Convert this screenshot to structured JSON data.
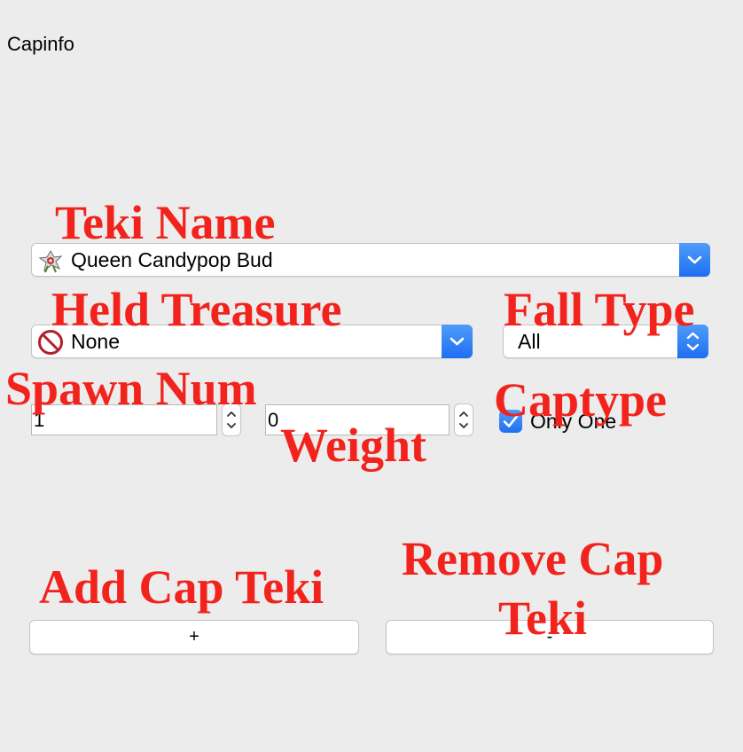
{
  "window": {
    "title": "Capinfo"
  },
  "annotations": {
    "teki_name": "Teki Name",
    "held_treasure": "Held Treasure",
    "fall_type": "Fall Type",
    "spawn_num": "Spawn Num",
    "weight": "Weight",
    "captype": "Captype",
    "add_cap_teki": "Add Cap Teki",
    "remove_cap_teki_line1": "Remove Cap",
    "remove_cap_teki_line2": "Teki"
  },
  "teki_select": {
    "value": "Queen Candypop Bud",
    "icon": "candypop-bud-icon"
  },
  "treasure_select": {
    "value": "None",
    "icon": "no-symbol-icon"
  },
  "fall_type_select": {
    "value": "All"
  },
  "spawn_num": {
    "value": "1"
  },
  "weight": {
    "value": "0"
  },
  "only_one_checkbox": {
    "label": "Only One",
    "checked": true
  },
  "add_button": {
    "label": "+"
  },
  "remove_button": {
    "label": "-"
  },
  "colors": {
    "annotation": "#f2231d",
    "accent": "#1e6ff2",
    "background": "#ececec"
  }
}
